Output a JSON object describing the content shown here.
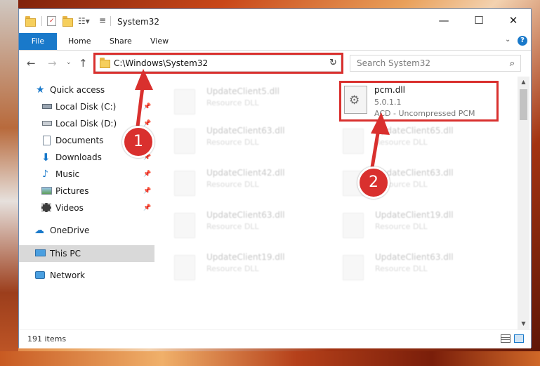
{
  "window": {
    "title": "System32",
    "controls": {
      "minimize": "—",
      "maximize": "☐",
      "close": "✕"
    }
  },
  "ribbon": {
    "tabs": [
      {
        "label": "File"
      },
      {
        "label": "Home"
      },
      {
        "label": "Share"
      },
      {
        "label": "View"
      }
    ]
  },
  "address": {
    "path": "C:\\Windows\\System32",
    "search_placeholder": "Search System32"
  },
  "nav": {
    "items": [
      {
        "label": "Quick access"
      },
      {
        "label": "Local Disk (C:)"
      },
      {
        "label": "Local Disk (D:)"
      },
      {
        "label": "Documents"
      },
      {
        "label": "Downloads"
      },
      {
        "label": "Music"
      },
      {
        "label": "Pictures"
      },
      {
        "label": "Videos"
      },
      {
        "label": "OneDrive"
      },
      {
        "label": "This PC"
      },
      {
        "label": "Network"
      }
    ]
  },
  "files": {
    "highlighted": {
      "name": "pcm.dll",
      "version": "5.0.1.1",
      "description": "ACD - Uncompressed PCM"
    },
    "ghost_items": [
      {
        "name": "UpdateClient5.dll",
        "type": "Resource DLL"
      },
      {
        "name": "UpdateClient63.dll",
        "type": "Resource DLL"
      },
      {
        "name": "UpdateClient65.dll",
        "type": "Resource DLL"
      },
      {
        "name": "UpdateClient42.dll",
        "type": "Resource DLL"
      },
      {
        "name": "UpdateClient63.dll",
        "type": "Resource DLL"
      },
      {
        "name": "UpdateClient63.dll",
        "type": "Resource DLL"
      },
      {
        "name": "UpdateClient19.dll",
        "type": "Resource DLL"
      },
      {
        "name": "UpdateClient19.dll",
        "type": "Resource DLL"
      },
      {
        "name": "UpdateClient63.dll",
        "type": "Resource DLL"
      }
    ]
  },
  "status": {
    "item_count": "191 items"
  },
  "annotations": {
    "step1": "1",
    "step2": "2"
  },
  "colors": {
    "accent": "#1979ca",
    "highlight": "#d9302e"
  }
}
